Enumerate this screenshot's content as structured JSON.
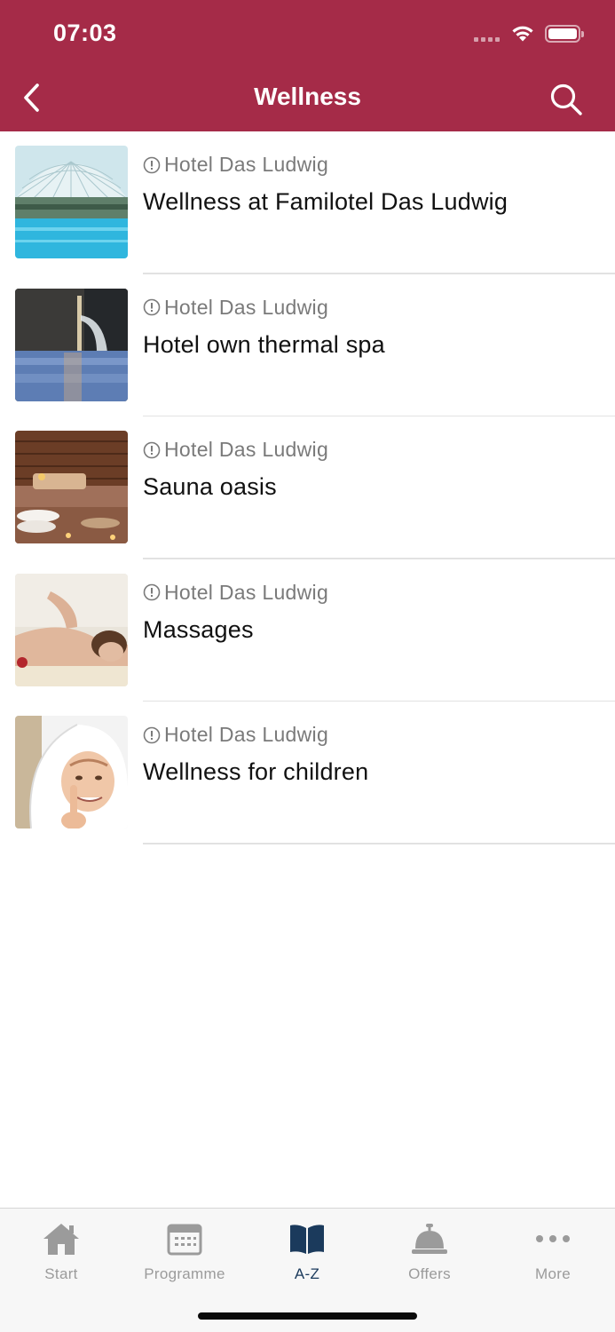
{
  "status_bar": {
    "time": "07:03"
  },
  "nav": {
    "title": "Wellness",
    "back_icon": "chevron-left-icon",
    "search_icon": "search-icon"
  },
  "colors": {
    "header": "#a52b48",
    "active_tab": "#1b3a5c",
    "inactive_tab": "#9b9b9b"
  },
  "items": [
    {
      "hotel": "Hotel Das Ludwig",
      "title": "Wellness at Familotel Das Ludwig",
      "image": "indoor-pool-glass-dome"
    },
    {
      "hotel": "Hotel Das Ludwig",
      "title": "Hotel own thermal spa",
      "image": "thermal-pool-waterfall"
    },
    {
      "hotel": "Hotel Das Ludwig",
      "title": "Sauna oasis",
      "image": "sauna-towels-candles"
    },
    {
      "hotel": "Hotel Das Ludwig",
      "title": "Massages",
      "image": "woman-massage"
    },
    {
      "hotel": "Hotel Das Ludwig",
      "title": "Wellness for children",
      "image": "child-in-towel"
    }
  ],
  "tabs": [
    {
      "label": "Start",
      "icon": "home-icon",
      "active": false
    },
    {
      "label": "Programme",
      "icon": "calendar-icon",
      "active": false
    },
    {
      "label": "A-Z",
      "icon": "book-icon",
      "active": true
    },
    {
      "label": "Offers",
      "icon": "service-bell-icon",
      "active": false
    },
    {
      "label": "More",
      "icon": "more-dots-icon",
      "active": false
    }
  ]
}
